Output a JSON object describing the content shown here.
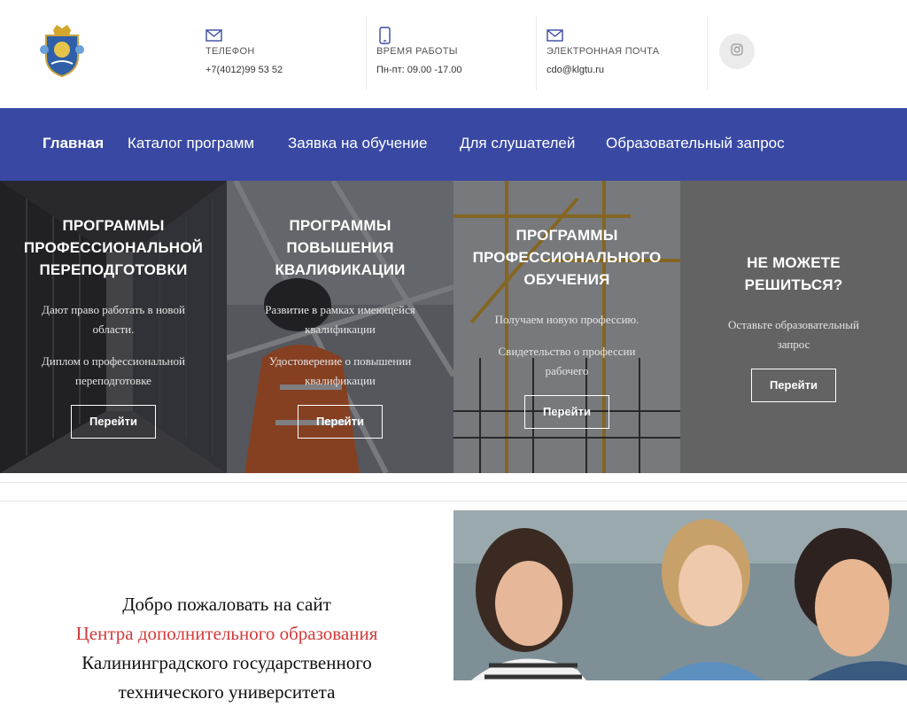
{
  "header": {
    "contacts": [
      {
        "icon": "mail-icon",
        "label": "ТЕЛЕФОН",
        "value": "+7(4012)99 53 52"
      },
      {
        "icon": "phone-icon",
        "label": "ВРЕМЯ РАБОТЫ",
        "value": "Пн-пт: 09.00 -17.00"
      },
      {
        "icon": "mail-icon",
        "label": "ЭЛЕКТРОННАЯ ПОЧТА",
        "value": "cdo@klgtu.ru"
      }
    ],
    "social_icon": "instagram-icon"
  },
  "nav": {
    "items": [
      {
        "label": "Главная",
        "active": true
      },
      {
        "label": "Каталог программ"
      },
      {
        "label": "Заявка на обучение"
      },
      {
        "label": "Для слушателей"
      },
      {
        "label": "Образовательный запрос"
      }
    ]
  },
  "cards": [
    {
      "title_lines": [
        "ПРОГРАММЫ",
        "ПРОФЕССИОНАЛЬНОЙ",
        "ПЕРЕПОДГОТОВКИ"
      ],
      "desc1": "Дают право работать в новой области.",
      "desc2": "Диплом о профессиональной переподготовке",
      "button": "Перейти"
    },
    {
      "title_lines": [
        "ПРОГРАММЫ",
        "ПОВЫШЕНИЯ",
        "КВАЛИФИКАЦИИ"
      ],
      "desc1": "Развитие в рамках имеющейся квалификации",
      "desc2": "Удостоверение о повышении квалификации",
      "button": "Перейти"
    },
    {
      "title_lines": [
        "ПРОГРАММЫ",
        "ПРОФЕССИОНАЛЬНОГО",
        "ОБУЧЕНИЯ"
      ],
      "desc1": "Получаем новую профессию.",
      "desc2": "Свидетельство о профессии рабочего",
      "button": "Перейти"
    },
    {
      "title_lines": [
        "НЕ МОЖЕТЕ",
        "РЕШИТЬСЯ?"
      ],
      "desc1": "Оставьте образовательный запрос",
      "button": "Перейти"
    }
  ],
  "welcome": {
    "line1": "Добро пожаловать на  сайт",
    "line2": "Центра дополнительного образования",
    "line3": "Калининградского государственного",
    "line4": "технического университета"
  },
  "colors": {
    "nav_bg": "#3949a3",
    "accent_red": "#d33a3a"
  }
}
